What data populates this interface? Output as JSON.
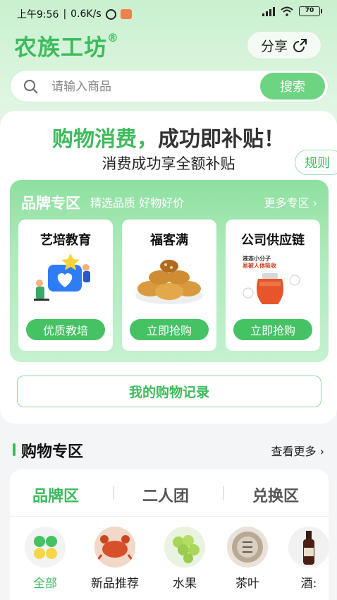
{
  "status_bar": {
    "time": "上午9:56",
    "speed": "0.6K/s",
    "battery": "70"
  },
  "header": {
    "logo": "农族工坊",
    "logo_mark": "®",
    "share_label": "分享"
  },
  "search": {
    "placeholder": "请输入商品",
    "button_label": "搜索"
  },
  "promo": {
    "headline_green": "购物消费，",
    "headline_dark": "成功即补贴！",
    "subheadline": "消费成功享全额补贴",
    "rules_label": "规则"
  },
  "brand_zone": {
    "title": "品牌专区",
    "subtitle": "精选品质 好物好价",
    "more_label": "更多专区",
    "cards": [
      {
        "name": "艺培教育",
        "button": "优质教培",
        "icon": "education-illustration-icon"
      },
      {
        "name": "福客满",
        "button": "立即抢购",
        "icon": "pastry-plate-icon"
      },
      {
        "name": "公司供应链",
        "button": "立即抢购",
        "icon": "juice-jar-icon",
        "image_text": "液态小分子\n易被人体吸收"
      }
    ]
  },
  "record_button": "我的购物记录",
  "shopping_zone": {
    "title": "购物专区",
    "more_label": "查看更多",
    "tabs": [
      "品牌区",
      "二人团",
      "兑换区"
    ],
    "active_tab": 0,
    "categories": [
      {
        "label": "全部",
        "icon": "grid-dots-icon"
      },
      {
        "label": "新品推荐",
        "icon": "crab-icon"
      },
      {
        "label": "水果",
        "icon": "grape-icon"
      },
      {
        "label": "茶叶",
        "icon": "tea-cake-icon"
      },
      {
        "label": "酒:",
        "icon": "wine-bottle-icon"
      }
    ]
  },
  "colors": {
    "brand_green": "#3dbb5c",
    "button_green": "#45c263",
    "search_button": "#6dd582"
  }
}
